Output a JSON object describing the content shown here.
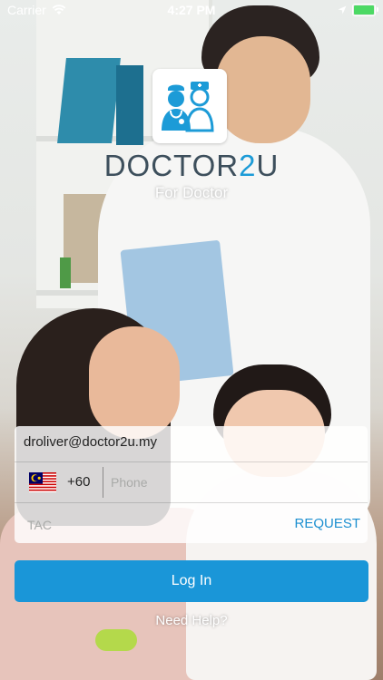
{
  "status_bar": {
    "carrier": "Carrier",
    "time": "4:27 PM",
    "wifi_icon": "wifi-icon",
    "location_icon": "location-arrow-icon",
    "battery_level": 1.0,
    "battery_color": "#4cd964"
  },
  "brand": {
    "logo_icon": "doctor-nurse-icon",
    "name_part1": "DOCTOR",
    "name_part2": "2",
    "name_part3": "U",
    "subtitle": "For Doctor",
    "accent_color": "#1c9bd7",
    "text_color": "#3d4f5c"
  },
  "form": {
    "email_value": "droliver@doctor2u.my",
    "country_flag": "malaysia-flag-icon",
    "country_code": "+60",
    "phone_placeholder": "Phone",
    "tac_placeholder": "TAC",
    "request_label": "REQUEST"
  },
  "actions": {
    "login_label": "Log In",
    "help_label": "Need Help?",
    "button_color": "#1a96d8"
  }
}
